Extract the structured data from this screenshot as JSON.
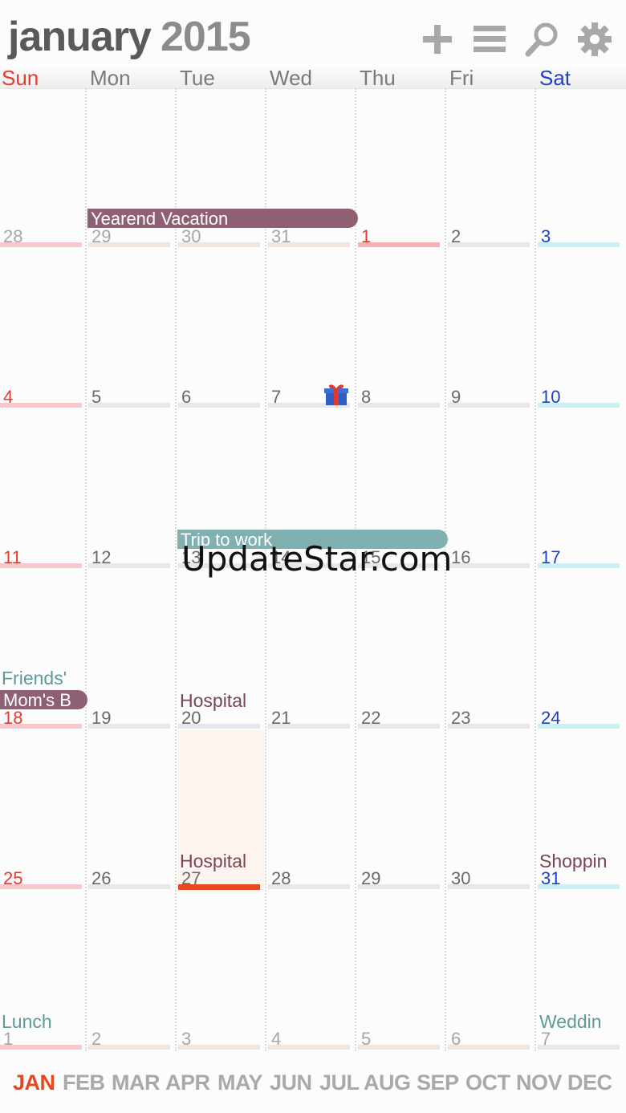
{
  "header": {
    "month": "january",
    "year": "2015",
    "icons": [
      "add-icon",
      "list-icon",
      "search-icon",
      "gear-icon"
    ]
  },
  "weekdays": [
    "Sun",
    "Mon",
    "Tue",
    "Wed",
    "Thu",
    "Fri",
    "Sat"
  ],
  "colors": {
    "sunday": "#e8392d",
    "saturday": "#1e3fc8",
    "weekday": "#6a6a6a",
    "faded": "#a6a6a6",
    "purple_event": "#8f6074",
    "teal_event": "#80b0b0",
    "teal_text": "#5e9a97",
    "purple_text": "#7a4458",
    "accent_red": "#e54a1e"
  },
  "weeks": [
    [
      "28",
      "29",
      "30",
      "31",
      "1",
      "2",
      "3"
    ],
    [
      "4",
      "5",
      "6",
      "7",
      "8",
      "9",
      "10"
    ],
    [
      "11",
      "12",
      "13",
      "14",
      "15",
      "16",
      "17"
    ],
    [
      "18",
      "19",
      "20",
      "21",
      "22",
      "23",
      "24"
    ],
    [
      "25",
      "26",
      "27",
      "28",
      "29",
      "30",
      "31"
    ],
    [
      "1",
      "2",
      "3",
      "4",
      "5",
      "6",
      "7"
    ]
  ],
  "events": {
    "yearend_vacation": "Yearend Vacation",
    "trip_to_work": "Trip to work",
    "friends": "Friends'",
    "moms_b": "Mom's B",
    "hospital_1": "Hospital",
    "hospital_2": "Hospital",
    "shopping": "Shoppin",
    "lunch": "Lunch",
    "wedding": "Weddin",
    "gift_icon": "gift-icon"
  },
  "months": [
    "JAN",
    "FEB",
    "MAR",
    "APR",
    "MAY",
    "JUN",
    "JUL",
    "AUG",
    "SEP",
    "OCT",
    "NOV",
    "DEC"
  ],
  "selected_month": "JAN",
  "watermark": "UpdateStar.com"
}
